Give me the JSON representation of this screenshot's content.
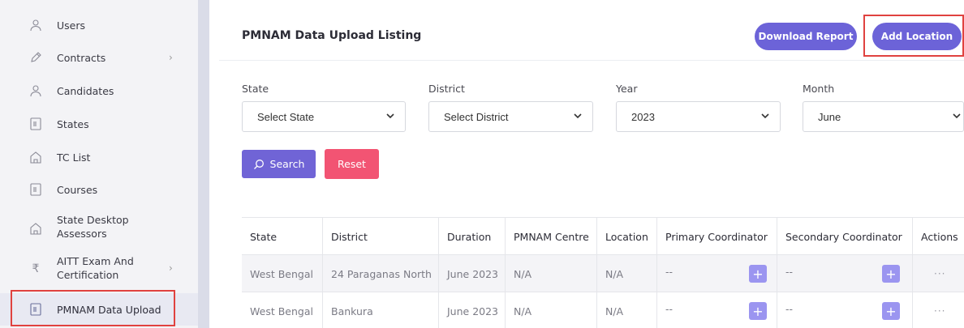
{
  "sidebar": {
    "items": [
      {
        "label": "Users",
        "icon": "user-icon"
      },
      {
        "label": "Contracts",
        "icon": "pen-icon",
        "chevron": "›"
      },
      {
        "label": "Candidates",
        "icon": "user-icon"
      },
      {
        "label": "States",
        "icon": "document-icon"
      },
      {
        "label": "TC List",
        "icon": "home-icon"
      },
      {
        "label": "Courses",
        "icon": "document-icon"
      },
      {
        "label": "State Desktop Assessors",
        "icon": "home-icon"
      },
      {
        "label": "AITT Exam And Certification",
        "icon": "rupee-icon",
        "chevron": "›"
      },
      {
        "label": "PMNAM Data Upload",
        "icon": "document-icon"
      }
    ],
    "rupee_glyph": "₹"
  },
  "header": {
    "title": "PMNAM Data Upload Listing",
    "download_label": "Download Report",
    "add_location_label": "Add Location"
  },
  "filters": {
    "state": {
      "label": "State",
      "value": "Select State"
    },
    "district": {
      "label": "District",
      "value": "Select District"
    },
    "year": {
      "label": "Year",
      "value": "2023"
    },
    "month": {
      "label": "Month",
      "value": "June"
    }
  },
  "buttons": {
    "search_label": "Search",
    "reset_label": "Reset"
  },
  "table": {
    "columns": [
      "State",
      "District",
      "Duration",
      "PMNAM Centre",
      "Location",
      "Primary Coordinator",
      "Secondary Coordinator",
      "Actions"
    ],
    "rows": [
      {
        "state": "West Bengal",
        "district": "24 Paraganas North",
        "duration": "June 2023",
        "centre": "N/A",
        "location": "N/A",
        "primary": "--",
        "secondary": "--",
        "actions": "···"
      },
      {
        "state": "West Bengal",
        "district": "Bankura",
        "duration": "June 2023",
        "centre": "N/A",
        "location": "N/A",
        "primary": "--",
        "secondary": "--",
        "actions": "···"
      }
    ],
    "plus_glyph": "+"
  },
  "colors": {
    "primary": "#6c63d8",
    "reset": "#f25473",
    "highlight": "#e0423f",
    "plus": "#9b95f0"
  }
}
